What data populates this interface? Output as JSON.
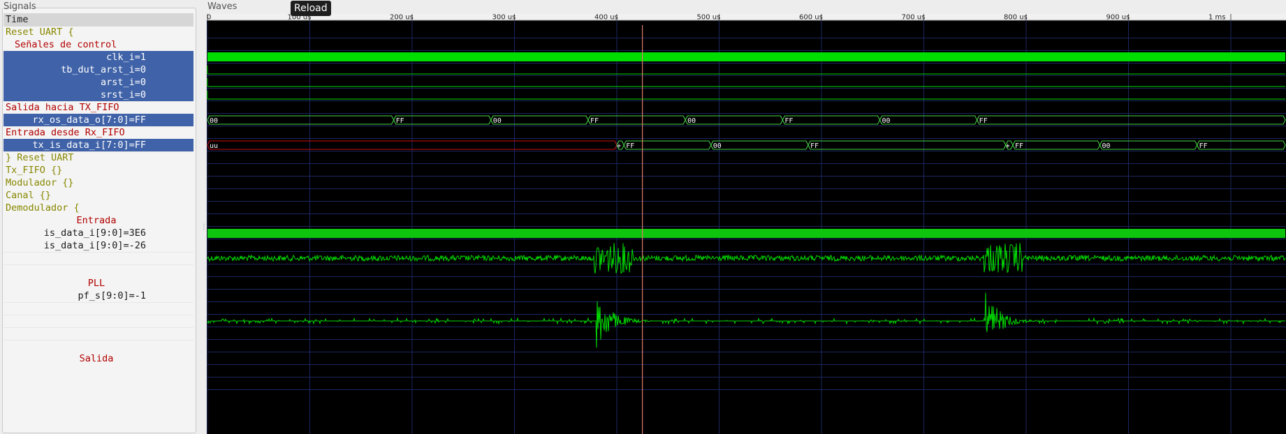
{
  "signals_pane": {
    "title": "Signals"
  },
  "waves_pane": {
    "title": "Waves",
    "tooltip": "Reload"
  },
  "time_axis": {
    "ticks": [
      {
        "label": "0",
        "us": 0
      },
      {
        "label": "100 us",
        "us": 100
      },
      {
        "label": "200 us",
        "us": 200
      },
      {
        "label": "300 us",
        "us": 300
      },
      {
        "label": "400 us",
        "us": 400
      },
      {
        "label": "500 us",
        "us": 500
      },
      {
        "label": "600 us",
        "us": 600
      },
      {
        "label": "700 us",
        "us": 700
      },
      {
        "label": "800 us",
        "us": 800
      },
      {
        "label": "900 us",
        "us": 900
      },
      {
        "label": "1 ms",
        "us": 1000
      }
    ],
    "cursor_us": 425
  },
  "signals": [
    {
      "label": "Time",
      "kind": "time"
    },
    {
      "label": "Reset UART {",
      "kind": "group"
    },
    {
      "label": "Señales de control",
      "kind": "comment",
      "align": "left",
      "indent": 16
    },
    {
      "label": "clk_i=1",
      "kind": "selected",
      "align": "right",
      "indent": 70
    },
    {
      "label": "tb_dut_arst_i=0",
      "kind": "selected",
      "align": "right",
      "indent": 70
    },
    {
      "label": "arst_i=0",
      "kind": "selected",
      "align": "right",
      "indent": 70
    },
    {
      "label": "srst_i=0",
      "kind": "selected",
      "align": "right",
      "indent": 70
    },
    {
      "label": "Salida hacia TX_FIFO",
      "kind": "comment",
      "align": "left",
      "indent": 3
    },
    {
      "label": "rx_os_data_o[7:0]=FF",
      "kind": "selected",
      "align": "right",
      "indent": 70
    },
    {
      "label": "Entrada desde Rx_FIFO",
      "kind": "comment",
      "align": "left",
      "indent": 3
    },
    {
      "label": "tx_is_data_i[7:0]=FF",
      "kind": "selected",
      "align": "right",
      "indent": 70
    },
    {
      "label": "} Reset UART",
      "kind": "group"
    },
    {
      "label": "Tx_FIFO {}",
      "kind": "group"
    },
    {
      "label": "Modulador {}",
      "kind": "group"
    },
    {
      "label": "Canal {}",
      "kind": "group"
    },
    {
      "label": "Demodulador {",
      "kind": "group"
    },
    {
      "label": "Entrada",
      "kind": "comment",
      "align": "center"
    },
    {
      "label": "is_data_i[9:0]=3E6",
      "kind": "plain",
      "align": "right",
      "indent": 70
    },
    {
      "label": "is_data_i[9:0]=-26",
      "kind": "plain",
      "align": "right",
      "indent": 70
    },
    {
      "label": "",
      "kind": "sep"
    },
    {
      "label": "",
      "kind": "sep"
    },
    {
      "label": "PLL",
      "kind": "comment",
      "align": "center"
    },
    {
      "label": "pf_s[9:0]=-1",
      "kind": "plain",
      "align": "right",
      "indent": 70
    },
    {
      "label": "",
      "kind": "sep"
    },
    {
      "label": "",
      "kind": "sep"
    },
    {
      "label": "",
      "kind": "sep"
    },
    {
      "label": "",
      "kind": "sep"
    },
    {
      "label": "Salida",
      "kind": "comment",
      "align": "center"
    }
  ],
  "buses": [
    {
      "signal": "rx_os_data_o[7:0]",
      "segments": [
        {
          "from_us": 0,
          "to_us": 182,
          "value": "00"
        },
        {
          "from_us": 182,
          "to_us": 277,
          "value": "FF"
        },
        {
          "from_us": 277,
          "to_us": 372,
          "value": "00"
        },
        {
          "from_us": 372,
          "to_us": 467,
          "value": "FF"
        },
        {
          "from_us": 467,
          "to_us": 562,
          "value": "00"
        },
        {
          "from_us": 562,
          "to_us": 657,
          "value": "FF"
        },
        {
          "from_us": 657,
          "to_us": 752,
          "value": "00"
        },
        {
          "from_us": 752,
          "to_us": 1054,
          "value": "FF"
        }
      ]
    },
    {
      "signal": "tx_is_data_i[7:0]",
      "segments": [
        {
          "from_us": 0,
          "to_us": 400,
          "value": "uu",
          "undefined": true
        },
        {
          "from_us": 400,
          "to_us": 407,
          "value": "+"
        },
        {
          "from_us": 407,
          "to_us": 492,
          "value": "FF"
        },
        {
          "from_us": 492,
          "to_us": 587,
          "value": "00"
        },
        {
          "from_us": 587,
          "to_us": 780,
          "value": "FF"
        },
        {
          "from_us": 780,
          "to_us": 787,
          "value": "+"
        },
        {
          "from_us": 787,
          "to_us": 872,
          "value": "FF"
        },
        {
          "from_us": 872,
          "to_us": 967,
          "value": "00"
        },
        {
          "from_us": 967,
          "to_us": 1054,
          "value": "FF"
        }
      ]
    }
  ],
  "colors": {
    "wave": "#00dd00",
    "bus_edge": "#48d848",
    "undefined": "#d01010",
    "grid": "#1c2660",
    "cursor": "#e07c6c",
    "selected_row": "#3f62a8",
    "group_text": "#878700",
    "comment_text": "#b20000"
  }
}
